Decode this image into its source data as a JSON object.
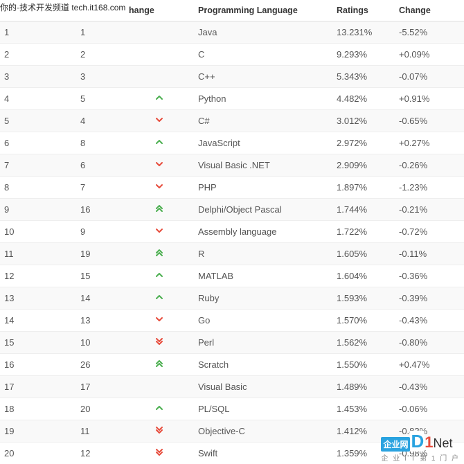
{
  "watermark_top": "你的·技术开发频道  tech.it168.com",
  "watermark_bottom": {
    "box": "企业网",
    "d": "D",
    "one": "1",
    "net": "Net",
    "sub": "企 业 I T 第 1 门 户"
  },
  "headers": {
    "col_a": "",
    "col_b": "",
    "col_c": "hange",
    "col_d": "Programming Language",
    "col_e": "Ratings",
    "col_f": "Change"
  },
  "rows": [
    {
      "a": "1",
      "b": "1",
      "c": "",
      "d": "Java",
      "e": "13.231%",
      "f": "-5.52%"
    },
    {
      "a": "2",
      "b": "2",
      "c": "",
      "d": "C",
      "e": "9.293%",
      "f": "+0.09%"
    },
    {
      "a": "3",
      "b": "3",
      "c": "",
      "d": "C++",
      "e": "5.343%",
      "f": "-0.07%"
    },
    {
      "a": "4",
      "b": "5",
      "c": "up1",
      "d": "Python",
      "e": "4.482%",
      "f": "+0.91%"
    },
    {
      "a": "5",
      "b": "4",
      "c": "down1",
      "d": "C#",
      "e": "3.012%",
      "f": "-0.65%"
    },
    {
      "a": "6",
      "b": "8",
      "c": "up1",
      "d": "JavaScript",
      "e": "2.972%",
      "f": "+0.27%"
    },
    {
      "a": "7",
      "b": "6",
      "c": "down1",
      "d": "Visual Basic .NET",
      "e": "2.909%",
      "f": "-0.26%"
    },
    {
      "a": "8",
      "b": "7",
      "c": "down1",
      "d": "PHP",
      "e": "1.897%",
      "f": "-1.23%"
    },
    {
      "a": "9",
      "b": "16",
      "c": "up2",
      "d": "Delphi/Object Pascal",
      "e": "1.744%",
      "f": "-0.21%"
    },
    {
      "a": "10",
      "b": "9",
      "c": "down1",
      "d": "Assembly language",
      "e": "1.722%",
      "f": "-0.72%"
    },
    {
      "a": "11",
      "b": "19",
      "c": "up2",
      "d": "R",
      "e": "1.605%",
      "f": "-0.11%"
    },
    {
      "a": "12",
      "b": "15",
      "c": "up1",
      "d": "MATLAB",
      "e": "1.604%",
      "f": "-0.36%"
    },
    {
      "a": "13",
      "b": "14",
      "c": "up1",
      "d": "Ruby",
      "e": "1.593%",
      "f": "-0.39%"
    },
    {
      "a": "14",
      "b": "13",
      "c": "down1",
      "d": "Go",
      "e": "1.570%",
      "f": "-0.43%"
    },
    {
      "a": "15",
      "b": "10",
      "c": "down2",
      "d": "Perl",
      "e": "1.562%",
      "f": "-0.80%"
    },
    {
      "a": "16",
      "b": "26",
      "c": "up2",
      "d": "Scratch",
      "e": "1.550%",
      "f": "+0.47%"
    },
    {
      "a": "17",
      "b": "17",
      "c": "",
      "d": "Visual Basic",
      "e": "1.489%",
      "f": "-0.43%"
    },
    {
      "a": "18",
      "b": "20",
      "c": "up1",
      "d": "PL/SQL",
      "e": "1.453%",
      "f": "-0.06%"
    },
    {
      "a": "19",
      "b": "11",
      "c": "down2",
      "d": "Objective-C",
      "e": "1.412%",
      "f": "-0.83%"
    },
    {
      "a": "20",
      "b": "12",
      "c": "down2",
      "d": "Swift",
      "e": "1.359%",
      "f": "-0.98%"
    }
  ]
}
